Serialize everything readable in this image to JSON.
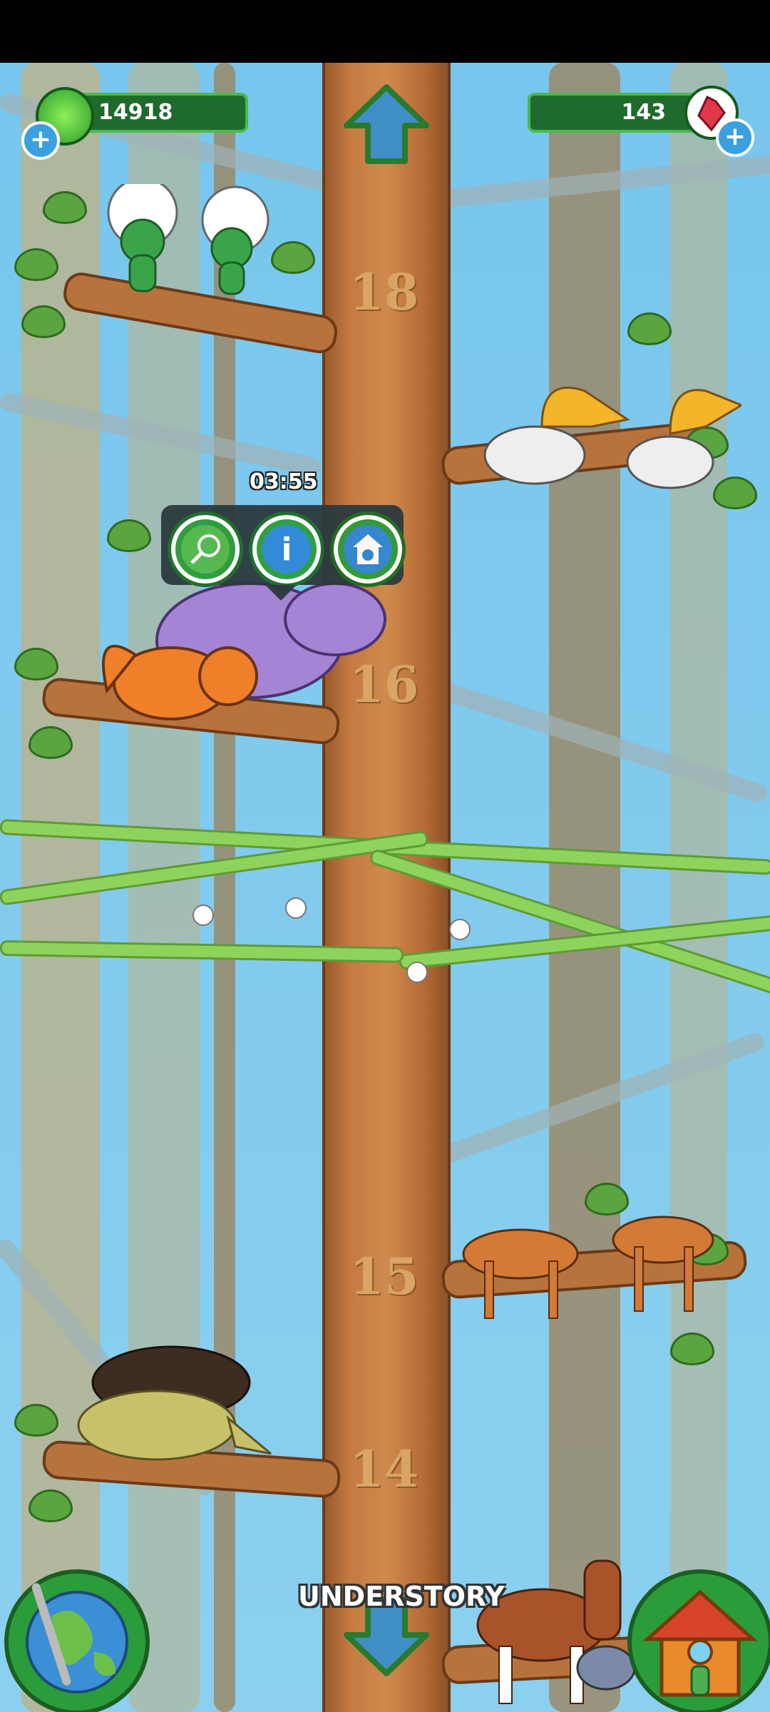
{
  "hud": {
    "coins": "14918",
    "gems": "143",
    "coin_add_icon": "plus-icon",
    "gem_add_icon": "plus-icon",
    "coin_icon": "green-gem-coin-icon",
    "gem_icon": "red-crystal-icon"
  },
  "levels": [
    "18",
    "16",
    "15",
    "14"
  ],
  "popup": {
    "timer": "03:55",
    "actions": [
      "net-icon",
      "info-icon",
      "animal-house-icon"
    ]
  },
  "zone_label": "UNDERSTORY",
  "nav": {
    "up_arrow": "up-arrow-icon",
    "down_arrow": "down-arrow-icon",
    "globe": "globe-icon",
    "house": "house-icon"
  },
  "colors": {
    "sky": "#78c6ee",
    "trunk": "#c47a41",
    "hud_bg": "#1e6b2d",
    "hud_border": "#4cb948",
    "vine": "#8ed35c"
  }
}
